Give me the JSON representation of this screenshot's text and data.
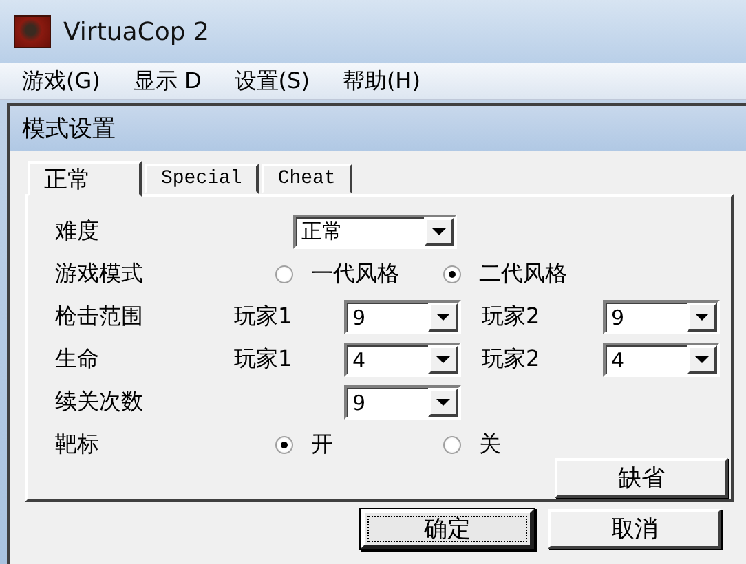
{
  "window": {
    "title": "VirtuaCop 2"
  },
  "menu": [
    "游戏(G)",
    "显示 D",
    "设置(S)",
    "帮助(H)"
  ],
  "dialog": {
    "title": "模式设置",
    "tabs": [
      {
        "label": "正常",
        "selected": true
      },
      {
        "label": "Special",
        "selected": false
      },
      {
        "label": "Cheat",
        "selected": false
      }
    ],
    "settings": [
      {
        "kind": "dropdown",
        "label": "难度",
        "value": "正常"
      },
      {
        "kind": "radio",
        "label": "游戏模式",
        "options": [
          {
            "label": "一代风格",
            "selected": false
          },
          {
            "label": "二代风格",
            "selected": true
          }
        ]
      },
      {
        "kind": "players",
        "label": "枪击范围",
        "players": [
          {
            "label": "玩家1",
            "value": "9"
          },
          {
            "label": "玩家2",
            "value": "9"
          }
        ]
      },
      {
        "kind": "players",
        "label": "生命",
        "players": [
          {
            "label": "玩家1",
            "value": "4"
          },
          {
            "label": "玩家2",
            "value": "4"
          }
        ]
      },
      {
        "kind": "dropdown",
        "label": "续关次数",
        "value": "9"
      },
      {
        "kind": "radio",
        "label": "靶标",
        "options": [
          {
            "label": "开",
            "selected": true
          },
          {
            "label": "关",
            "selected": false
          }
        ]
      }
    ],
    "default_button": "缺省",
    "buttons": [
      {
        "label": "确定",
        "focused": true
      },
      {
        "label": "取消",
        "focused": false
      }
    ]
  }
}
